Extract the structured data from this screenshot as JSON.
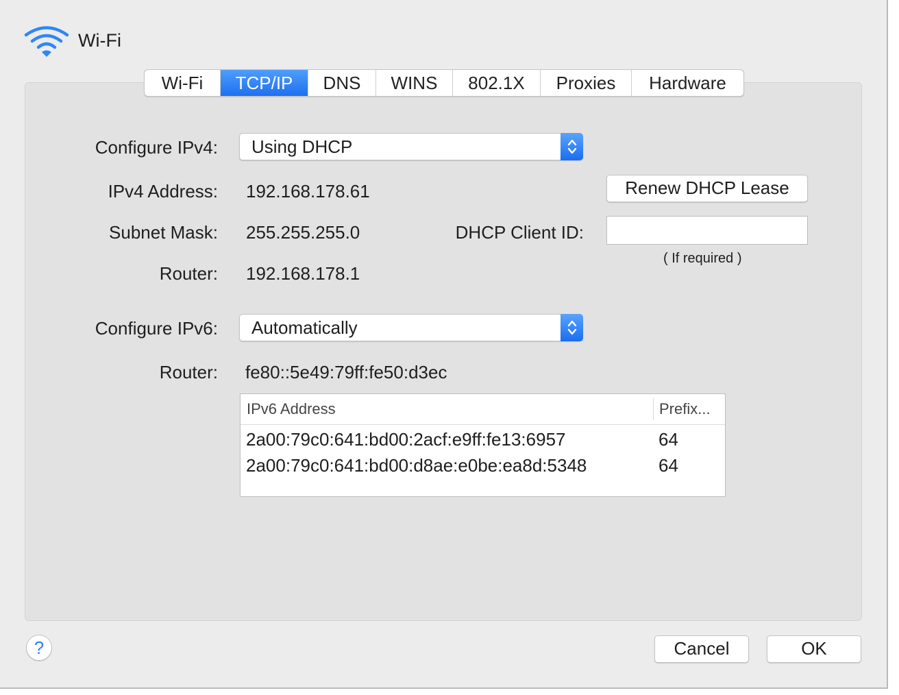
{
  "header": {
    "icon": "wifi-icon",
    "title": "Wi-Fi"
  },
  "tabs": [
    {
      "label": "Wi-Fi",
      "active": false
    },
    {
      "label": "TCP/IP",
      "active": true
    },
    {
      "label": "DNS",
      "active": false
    },
    {
      "label": "WINS",
      "active": false
    },
    {
      "label": "802.1X",
      "active": false
    },
    {
      "label": "Proxies",
      "active": false
    },
    {
      "label": "Hardware",
      "active": false
    }
  ],
  "ipv4": {
    "configure_label": "Configure IPv4:",
    "configure_value": "Using DHCP",
    "address_label": "IPv4 Address:",
    "address_value": "192.168.178.61",
    "subnet_label": "Subnet Mask:",
    "subnet_value": "255.255.255.0",
    "router_label": "Router:",
    "router_value": "192.168.178.1",
    "renew_button": "Renew DHCP Lease",
    "client_id_label": "DHCP Client ID:",
    "client_id_value": "",
    "client_id_note": "( If required )"
  },
  "ipv6": {
    "configure_label": "Configure IPv6:",
    "configure_value": "Automatically",
    "router_label": "Router:",
    "router_value": "fe80::5e49:79ff:fe50:d3ec",
    "table": {
      "columns": [
        "IPv6 Address",
        "Prefix..."
      ],
      "rows": [
        [
          "2a00:79c0:641:bd00:2acf:e9ff:fe13:6957",
          "64"
        ],
        [
          "2a00:79c0:641:bd00:d8ae:e0be:ea8d:5348",
          "64"
        ]
      ]
    }
  },
  "footer": {
    "help": "?",
    "cancel": "Cancel",
    "ok": "OK"
  },
  "colors": {
    "accent": "#2f7df7",
    "window_bg": "#ececec",
    "panel_bg": "#e2e2e2"
  }
}
